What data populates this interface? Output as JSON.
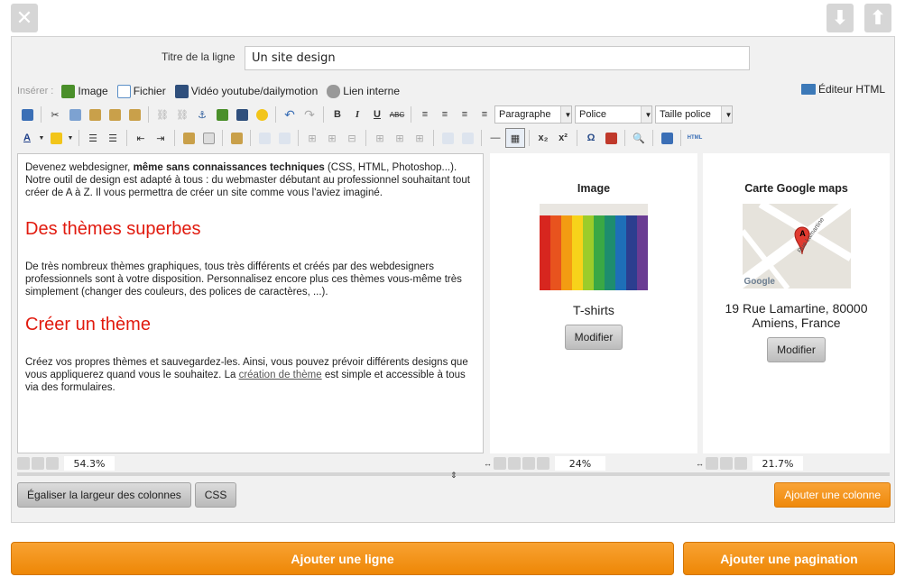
{
  "topbar": {
    "close_icon": "close-x-icon",
    "down_icon": "arrow-down-icon",
    "up_icon": "arrow-up-icon"
  },
  "row_title": {
    "label": "Titre de la ligne",
    "value": "Un site design"
  },
  "insert": {
    "label": "Insérer :",
    "items": [
      {
        "label": "Image",
        "icon": "image-icon",
        "color": "#4a8f2a"
      },
      {
        "label": "Fichier",
        "icon": "file-icon",
        "color": "#5b8fc7"
      },
      {
        "label": "Vidéo youtube/dailymotion",
        "icon": "film-icon",
        "color": "#2f4f7c"
      },
      {
        "label": "Lien interne",
        "icon": "link-icon",
        "color": "#777777"
      }
    ],
    "html_editor": "Éditeur HTML"
  },
  "toolbar": {
    "format_select": "Paragraphe",
    "font_select": "Police",
    "size_select": "Taille police"
  },
  "column1": {
    "intro_start": "Devenez webdesigner, ",
    "intro_bold": "même sans connaissances techniques",
    "intro_end": " (CSS, HTML, Photoshop...). Notre outil de design est adapté à tous : du webmaster débutant au professionnel souhaitant tout créer de A à Z. Il vous permettra de créer un site comme vous l'aviez imaginé.",
    "heading1": "Des thèmes superbes",
    "para2": "De très nombreux thèmes graphiques, tous très différents et créés par des webdesigners professionnels sont à votre disposition. Personnalisez encore plus ces thèmes vous-même très simplement (changer des couleurs, des polices de caractères, ...).",
    "heading2": "Créer un thème",
    "para3_start": "Créez vos propres thèmes et sauvegardez-les. Ainsi, vous pouvez prévoir différents designs que vous appliquerez quand vous le souhaitez. La ",
    "para3_link": "création de thème",
    "para3_end": " est simple et accessible à tous via des formulaires.",
    "width": "54.3%"
  },
  "column2": {
    "title": "Image",
    "caption": "T-shirts",
    "button": "Modifier",
    "width": "24%"
  },
  "column3": {
    "title": "Carte Google maps",
    "caption": "19 Rue Lamartine, 80000 Amiens, France",
    "button": "Modifier",
    "width": "21.7%",
    "map_label": "Google",
    "street_label": "Rue Lamartine",
    "marker_letter": "A"
  },
  "buttons": {
    "equalize": "Égaliser la largeur des colonnes",
    "css": "CSS",
    "add_column": "Ajouter une colonne",
    "add_row": "Ajouter une ligne",
    "add_pagination": "Ajouter une pagination"
  },
  "colors": {
    "accent_orange": "#f39417",
    "heading_red": "#e11a0e"
  }
}
